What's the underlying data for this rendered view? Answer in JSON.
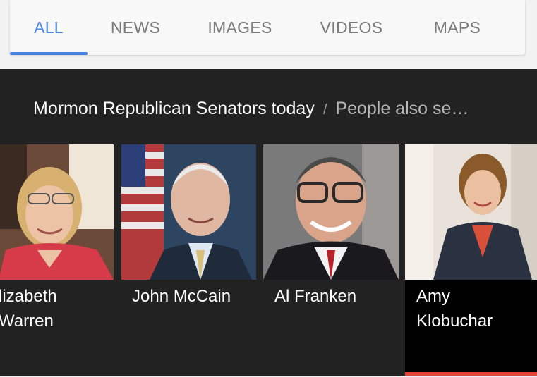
{
  "tabs": [
    {
      "label": "ALL",
      "active": true
    },
    {
      "label": "NEWS",
      "active": false
    },
    {
      "label": "IMAGES",
      "active": false
    },
    {
      "label": "VIDEOS",
      "active": false
    },
    {
      "label": "MAPS",
      "active": false
    }
  ],
  "header": {
    "title": "Mormon Republican Senators today",
    "separator": "/",
    "alt": "People also se…"
  },
  "people": [
    {
      "name": "Elizabeth\nWarren",
      "visible_name": "lizabeth\nWarren"
    },
    {
      "name": "John McCain"
    },
    {
      "name": "Al Franken"
    },
    {
      "name": "Amy\nKlobuchar",
      "selected": true
    }
  ],
  "colors": {
    "accent": "#4a84e0",
    "panel_bg": "#222222",
    "selected_bar": "#e0473f"
  }
}
